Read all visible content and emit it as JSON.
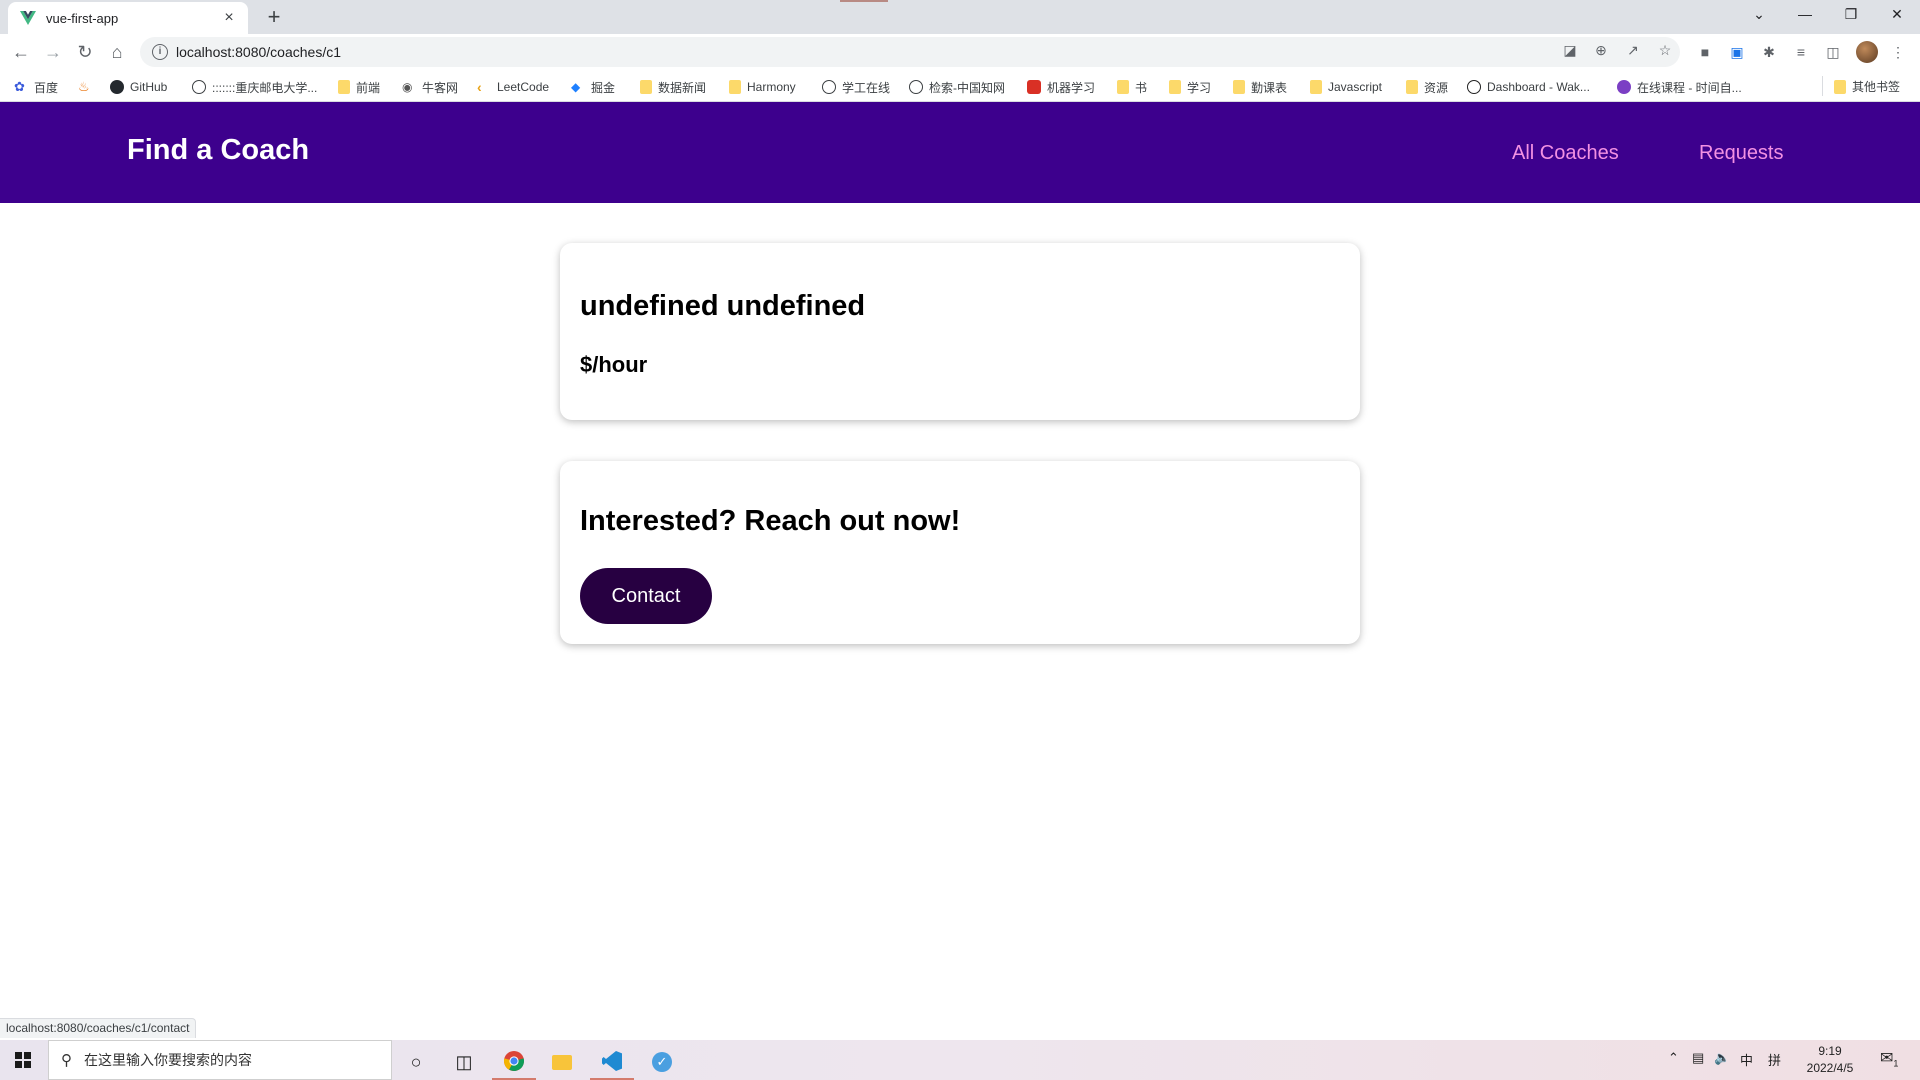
{
  "browser": {
    "tab_title": "vue-first-app",
    "tab_close": "×",
    "new_tab": "+",
    "url": "localhost:8080/coaches/c1",
    "status_url": "localhost:8080/coaches/c1/contact",
    "window_controls": {
      "minimize": "—",
      "restore": "❐",
      "close": "✕",
      "tab_search": "⌄"
    },
    "bookmarks": [
      {
        "label": "百度",
        "icon": "baidu-icon"
      },
      {
        "label": "",
        "icon": "bookmark-icon"
      },
      {
        "label": "GitHub",
        "icon": "github-icon"
      },
      {
        "label": ":::::::重庆邮电大学...",
        "icon": "globe-icon"
      },
      {
        "label": "前端",
        "icon": "folder-icon"
      },
      {
        "label": "牛客网",
        "icon": "nowcoder-icon"
      },
      {
        "label": "LeetCode",
        "icon": "leetcode-icon"
      },
      {
        "label": "掘金",
        "icon": "juejin-icon"
      },
      {
        "label": "数据新闻",
        "icon": "folder-icon"
      },
      {
        "label": "Harmony",
        "icon": "folder-icon"
      },
      {
        "label": "学工在线",
        "icon": "globe-icon"
      },
      {
        "label": "检索-中国知网",
        "icon": "globe-icon"
      },
      {
        "label": "机器学习",
        "icon": "ml-icon"
      },
      {
        "label": "书",
        "icon": "folder-icon"
      },
      {
        "label": "学习",
        "icon": "folder-icon"
      },
      {
        "label": "勤课表",
        "icon": "folder-icon"
      },
      {
        "label": "Javascript",
        "icon": "folder-icon"
      },
      {
        "label": "资源",
        "icon": "folder-icon"
      },
      {
        "label": "Dashboard - Wak...",
        "icon": "wakatime-icon"
      },
      {
        "label": "在线课程 - 时间自...",
        "icon": "course-icon"
      }
    ],
    "other_bookmarks": "其他书签"
  },
  "app": {
    "brand": "Find a Coach",
    "nav": {
      "all_coaches": "All Coaches",
      "requests": "Requests"
    },
    "coach": {
      "full_name": "undefined undefined",
      "rate": "$/hour"
    },
    "contact_card": {
      "heading": "Interested? Reach out now!",
      "button": "Contact"
    },
    "colors": {
      "header_bg": "#3d008d",
      "nav_link": "#f391e3",
      "button_bg": "#270041"
    }
  },
  "taskbar": {
    "search_placeholder": "在这里输入你要搜索的内容",
    "ime_lang": "中",
    "ime_mode": "拼",
    "time": "9:19",
    "date": "2022/4/5",
    "notification_count": "1"
  }
}
